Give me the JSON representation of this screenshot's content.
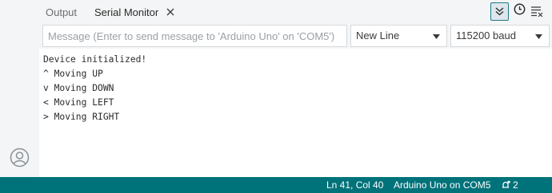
{
  "tabs": {
    "output": "Output",
    "serial_monitor": "Serial Monitor"
  },
  "toolbar": {
    "message_placeholder": "Message (Enter to send message to 'Arduino Uno' on 'COM5')",
    "line_ending": "New Line",
    "baud_rate": "115200 baud"
  },
  "serial_output": [
    "Device initialized!",
    "^ Moving UP",
    "v Moving DOWN",
    "< Moving LEFT",
    "> Moving RIGHT"
  ],
  "statusbar": {
    "cursor_position": "Ln 41, Col 40",
    "board": "Arduino Uno on COM5",
    "notification_count": "2"
  },
  "icons": {
    "close": "close-icon",
    "autoscroll": "double-chevron-down-icon",
    "timestamp": "clock-icon",
    "clear": "clear-output-icon",
    "account": "account-icon",
    "notifications": "notification-bell-icon"
  },
  "colors": {
    "statusbar": "#00727a",
    "panel_background": "#f4f5f6",
    "toggle_border": "#1c7a84"
  }
}
